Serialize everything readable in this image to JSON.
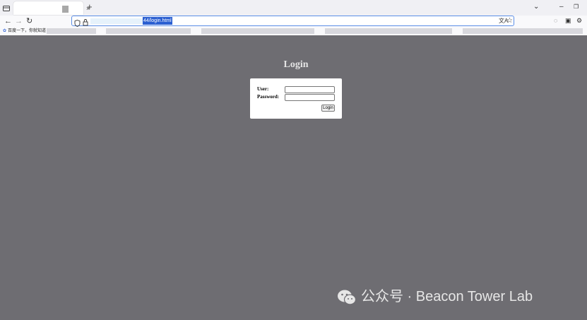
{
  "browser": {
    "tab": {
      "close_glyph": "×"
    },
    "new_tab_glyph": "+",
    "window_controls": {
      "dropdown": "⌄",
      "minimize": "–",
      "restore": "❐"
    },
    "nav": {
      "back": "←",
      "forward": "→",
      "reload": "↻"
    },
    "url": {
      "visible_text": "44/login.html"
    },
    "bookmarks": [
      {
        "label": "百度一下，你就知道"
      }
    ]
  },
  "page": {
    "title": "Login",
    "form": {
      "user_label": "User:",
      "user_value": "",
      "password_label": "Password:",
      "password_value": "",
      "submit_label": "Login"
    }
  },
  "watermark": {
    "text": "公众号 · Beacon Tower Lab"
  },
  "colors": {
    "page_background": "#6e6d72",
    "title_text": "#e4e4e4",
    "url_selection": "#2b5fd1",
    "chrome_background": "#f0f0f4"
  }
}
